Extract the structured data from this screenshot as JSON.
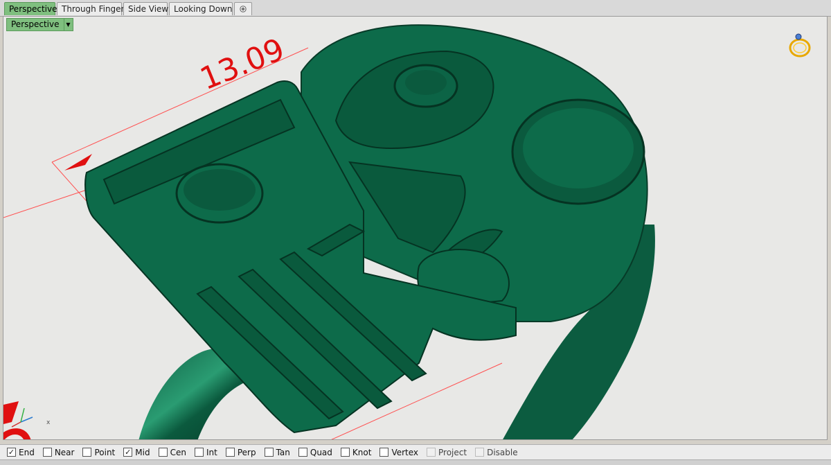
{
  "tabs": [
    {
      "label": "Perspective",
      "active": true
    },
    {
      "label": "Through Finger",
      "active": false
    },
    {
      "label": "Side View",
      "active": false
    },
    {
      "label": "Looking Down",
      "active": false
    }
  ],
  "tab_add_icon": "plus-icon",
  "viewport": {
    "title": "Perspective",
    "dropdown_icon": "triangle-down-icon",
    "dimension_text": "13.09",
    "dimension_color": "#e01010",
    "model_color": "#0d6b4a",
    "navigation_icon": "ring-icon"
  },
  "osnap": [
    {
      "label": "End",
      "checked": true,
      "enabled": true
    },
    {
      "label": "Near",
      "checked": false,
      "enabled": true
    },
    {
      "label": "Point",
      "checked": false,
      "enabled": true
    },
    {
      "label": "Mid",
      "checked": true,
      "enabled": true
    },
    {
      "label": "Cen",
      "checked": false,
      "enabled": true
    },
    {
      "label": "Int",
      "checked": false,
      "enabled": true
    },
    {
      "label": "Perp",
      "checked": false,
      "enabled": true
    },
    {
      "label": "Tan",
      "checked": false,
      "enabled": true
    },
    {
      "label": "Quad",
      "checked": false,
      "enabled": true
    },
    {
      "label": "Knot",
      "checked": false,
      "enabled": true
    },
    {
      "label": "Vertex",
      "checked": false,
      "enabled": true
    },
    {
      "label": "Project",
      "checked": false,
      "enabled": false
    },
    {
      "label": "Disable",
      "checked": false,
      "enabled": false
    }
  ],
  "check_mark": "✓"
}
